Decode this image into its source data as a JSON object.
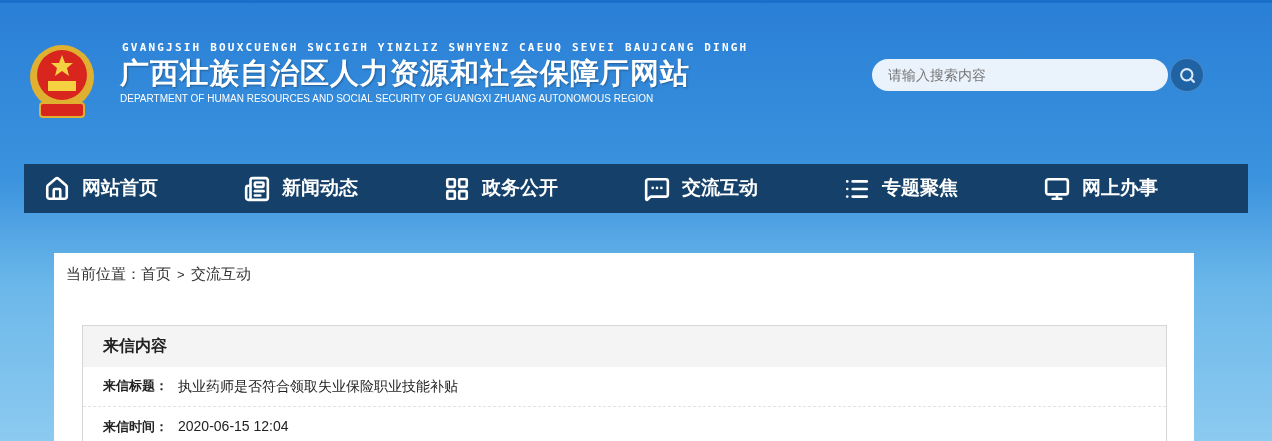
{
  "header": {
    "subtitle_zhuang": "GVANGJSIH BOUXCUENGH SWCIGIH YINZLIZ SWHYENZ CAEUQ SEVEI BAUJCANG DINGH",
    "title": "广西壮族自治区人力资源和社会保障厅网站",
    "subtitle_en": "DEPARTMENT OF HUMAN RESOURCES AND SOCIAL SECURITY OF GUANGXI ZHUANG AUTONOMOUS REGION"
  },
  "search": {
    "placeholder": "请输入搜索内容"
  },
  "nav": [
    {
      "label": "网站首页"
    },
    {
      "label": "新闻动态"
    },
    {
      "label": "政务公开"
    },
    {
      "label": "交流互动"
    },
    {
      "label": "专题聚焦"
    },
    {
      "label": "网上办事"
    }
  ],
  "breadcrumb": {
    "prefix": "当前位置：",
    "items": [
      "首页",
      "交流互动"
    ],
    "separator": ">"
  },
  "letter": {
    "heading": "来信内容",
    "fields": [
      {
        "label": "来信标题：",
        "value": "执业药师是否符合领取失业保险职业技能补贴"
      },
      {
        "label": "来信时间：",
        "value": "2020-06-15 12:04"
      }
    ]
  }
}
